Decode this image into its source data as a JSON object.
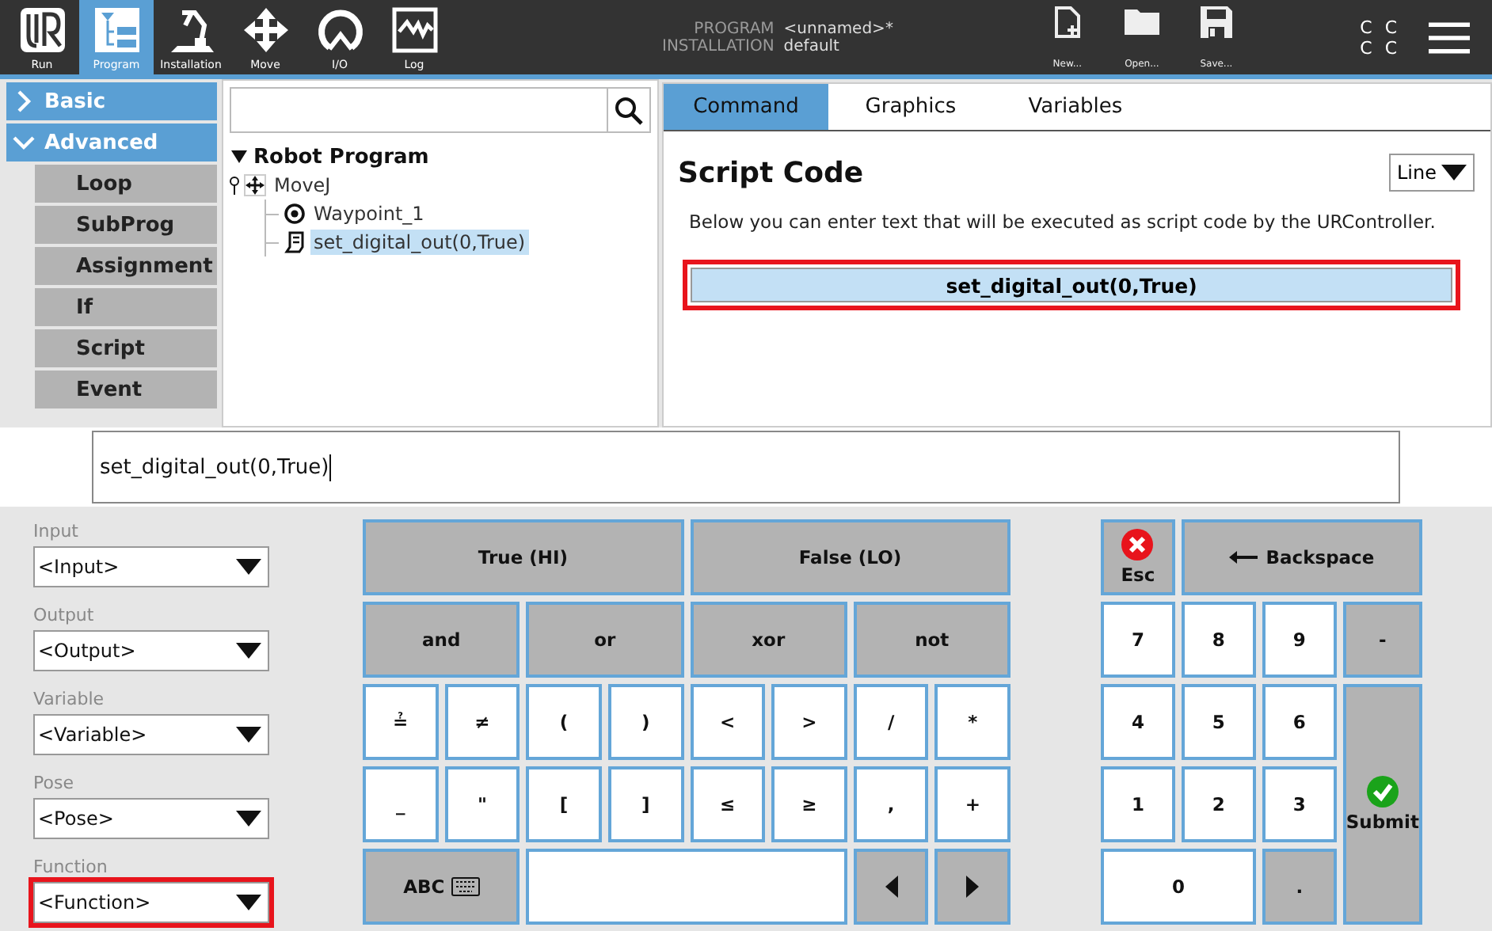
{
  "top_bar": {
    "nav": [
      {
        "label": "Run",
        "kind": "logo",
        "selected": false
      },
      {
        "label": "Program",
        "kind": "program",
        "selected": true
      },
      {
        "label": "Installation",
        "kind": "robot",
        "selected": false
      },
      {
        "label": "Move",
        "kind": "move",
        "selected": false
      },
      {
        "label": "I/O",
        "kind": "io",
        "selected": false
      },
      {
        "label": "Log",
        "kind": "log",
        "selected": false
      }
    ],
    "program_info": [
      {
        "label": "PROGRAM",
        "value": "<unnamed>*"
      },
      {
        "label": "INSTALLATION",
        "value": "default"
      }
    ],
    "file_buttons": [
      {
        "label": "New...",
        "kind": "new"
      },
      {
        "label": "Open...",
        "kind": "open"
      },
      {
        "label": "Save...",
        "kind": "save"
      }
    ],
    "status": [
      "C",
      "C",
      "C",
      "C"
    ]
  },
  "sidebar": {
    "groups": [
      {
        "label": "Basic",
        "expanded": false
      },
      {
        "label": "Advanced",
        "expanded": true,
        "children": [
          "Loop",
          "SubProg",
          "Assignment",
          "If",
          "Script",
          "Event"
        ]
      }
    ]
  },
  "tree": {
    "root": {
      "label": "Robot Program",
      "expanded": true,
      "children": [
        {
          "label": "MoveJ",
          "kind": "move",
          "selected": false,
          "children": [
            {
              "label": "Waypoint_1",
              "kind": "waypoint",
              "selected": false
            },
            {
              "label": "set_digital_out(0,True)",
              "kind": "script",
              "selected": true
            }
          ]
        }
      ]
    }
  },
  "command_panel": {
    "tabs": [
      {
        "label": "Command",
        "selected": true
      },
      {
        "label": "Graphics",
        "selected": false
      },
      {
        "label": "Variables",
        "selected": false
      }
    ],
    "title": "Script Code",
    "mode": "Line",
    "description": "Below you can enter text that will be executed as script code by the URController.",
    "script_line": {
      "value": "set_digital_out(0,True)",
      "highlighted": true
    }
  },
  "expression_field": {
    "value": "set_digital_out(0,True)"
  },
  "keyboard": {
    "selectors": [
      {
        "label": "Input",
        "value": "<Input>",
        "highlighted": false
      },
      {
        "label": "Output",
        "value": "<Output>",
        "highlighted": false
      },
      {
        "label": "Variable",
        "value": "<Variable>",
        "highlighted": false
      },
      {
        "label": "Pose",
        "value": "<Pose>",
        "highlighted": false
      },
      {
        "label": "Function",
        "value": "<Function>",
        "highlighted": true
      }
    ],
    "key_rows": [
      [
        {
          "label": "True (HI)",
          "kind": "action"
        },
        {
          "label": "False (LO)",
          "kind": "action"
        }
      ],
      [
        {
          "label": "and",
          "kind": "action"
        },
        {
          "label": "or",
          "kind": "action"
        },
        {
          "label": "xor",
          "kind": "action"
        },
        {
          "label": "not",
          "kind": "action"
        }
      ],
      [
        {
          "label": "≟",
          "kind": "char"
        },
        {
          "label": "≠",
          "kind": "char"
        },
        {
          "label": "(",
          "kind": "char"
        },
        {
          "label": ")",
          "kind": "char"
        },
        {
          "label": "<",
          "kind": "char"
        },
        {
          "label": ">",
          "kind": "char"
        },
        {
          "label": "/",
          "kind": "char"
        },
        {
          "label": "*",
          "kind": "char"
        }
      ],
      [
        {
          "label": "_",
          "kind": "char"
        },
        {
          "label": "\"",
          "kind": "char"
        },
        {
          "label": "[",
          "kind": "char"
        },
        {
          "label": "]",
          "kind": "char"
        },
        {
          "label": "≤",
          "kind": "char"
        },
        {
          "label": "≥",
          "kind": "char"
        },
        {
          "label": ",",
          "kind": "char"
        },
        {
          "label": "+",
          "kind": "char"
        }
      ],
      [
        {
          "label": "ABC",
          "kind": "toggle"
        },
        {
          "kind": "space"
        },
        {
          "kind": "left"
        },
        {
          "kind": "right"
        }
      ]
    ],
    "numpad": [
      {
        "label": "Esc",
        "kind": "cancel"
      },
      {
        "label": "Backspace",
        "kind": "erase"
      },
      {
        "label": "7",
        "kind": "digit"
      },
      {
        "label": "8",
        "kind": "digit"
      },
      {
        "label": "9",
        "kind": "digit"
      },
      {
        "label": "-",
        "kind": "sign"
      },
      {
        "label": "4",
        "kind": "digit"
      },
      {
        "label": "5",
        "kind": "digit"
      },
      {
        "label": "6",
        "kind": "digit"
      },
      {
        "label": "Submit",
        "kind": "submit"
      },
      {
        "label": "1",
        "kind": "digit"
      },
      {
        "label": "2",
        "kind": "digit"
      },
      {
        "label": "3",
        "kind": "digit"
      },
      {
        "label": "0",
        "kind": "zero"
      },
      {
        "label": ".",
        "kind": "point"
      }
    ]
  }
}
